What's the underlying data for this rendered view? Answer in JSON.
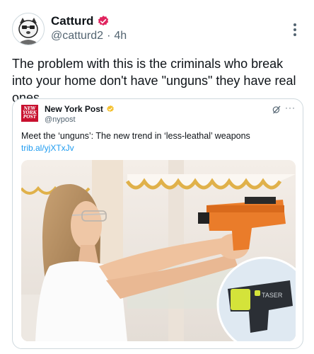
{
  "tweet": {
    "display_name": "Catturd",
    "handle": "@catturd2",
    "separator": "·",
    "time": "4h",
    "text": "The problem with this is the criminals who break into your home don't have \"unguns\" they have real ones."
  },
  "quoted": {
    "display_name": "New York Post",
    "handle": "@nypost",
    "logo_text": [
      "NEW",
      "YORK",
      "POST"
    ],
    "more": "···",
    "text": "Meet the ‘unguns’: The new trend in ‘less-leathal’ weapons",
    "link": "trib.al/yjXTxJv",
    "product_brand": "TASER"
  },
  "colors": {
    "verified_badge": "#e0245e",
    "verified_gold": "#f4c02d",
    "link": "#1d9bf0",
    "nyp_red": "#c8102e"
  }
}
